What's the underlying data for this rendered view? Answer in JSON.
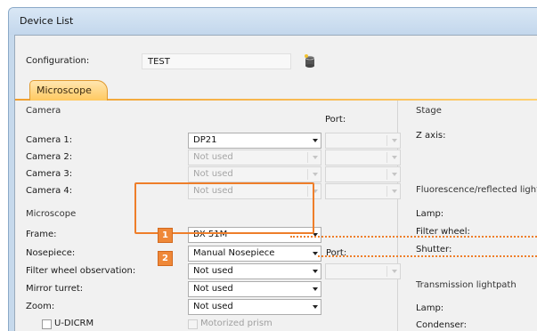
{
  "window": {
    "title": "Device List"
  },
  "configuration": {
    "label": "Configuration:",
    "value": "TEST",
    "icon": "database-icon"
  },
  "tabs": [
    {
      "label": "Microscope",
      "active": true
    }
  ],
  "camera": {
    "section": "Camera",
    "port_header": "Port:",
    "rows": [
      {
        "label": "Camera 1:",
        "value": "DP21",
        "enabled": true
      },
      {
        "label": "Camera 2:",
        "value": "Not used",
        "enabled": false
      },
      {
        "label": "Camera 3:",
        "value": "Not used",
        "enabled": false
      },
      {
        "label": "Camera 4:",
        "value": "Not used",
        "enabled": false
      }
    ]
  },
  "microscope": {
    "section": "Microscope",
    "frame": {
      "label": "Frame:",
      "value": "BX 51M",
      "badge": "1"
    },
    "nosepiece": {
      "label": "Nosepiece:",
      "value": "Manual Nosepiece",
      "badge": "2",
      "port_label": "Port:"
    },
    "filter_wheel": {
      "label": "Filter wheel observation:",
      "value": "Not used"
    },
    "mirror_turret": {
      "label": "Mirror turret:",
      "value": "Not used"
    },
    "zoom": {
      "label": "Zoom:",
      "value": "Not used"
    },
    "udicrm": {
      "label": "U-DICRM",
      "checked": false
    },
    "motorized_prism": {
      "label": "Motorized prism",
      "checked": false
    }
  },
  "stage": {
    "section": "Stage",
    "z_axis": "Z axis:"
  },
  "fluorescence": {
    "section": "Fluorescence/reflected lightp",
    "lamp": "Lamp:",
    "filter_wheel": "Filter wheel:",
    "shutter": "Shutter:"
  },
  "transmission": {
    "section": "Transmission lightpath",
    "lamp": "Lamp:",
    "condenser": "Condenser:"
  },
  "colors": {
    "highlight": "#ee7e2a",
    "tab": "#ffc960",
    "title_bg": "#c6d9ec"
  }
}
